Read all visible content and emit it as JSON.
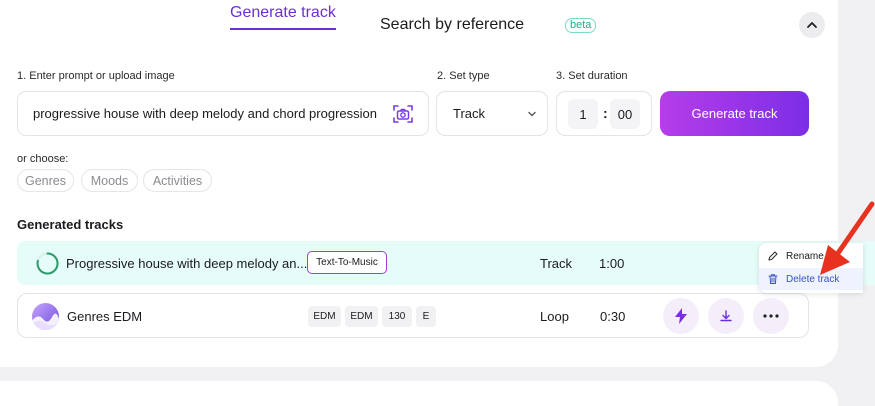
{
  "header": {
    "tab_generate": "Generate track",
    "tab_search": "Search by reference",
    "beta_badge": "beta"
  },
  "form": {
    "step1_label": "1. Enter prompt or upload image",
    "step2_label": "2. Set type",
    "step3_label": "3. Set duration",
    "prompt_value": "progressive house with deep melody and chord progression",
    "type_value": "Track",
    "duration_minutes": "1",
    "duration_separator": ":",
    "duration_seconds": "00",
    "generate_button": "Generate track"
  },
  "choose": {
    "label": "or choose:",
    "chips": [
      "Genres",
      "Moods",
      "Activities"
    ]
  },
  "generated": {
    "title": "Generated tracks",
    "rows": [
      {
        "title": "Progressive house with deep melody an...",
        "badge": "Text-To-Music",
        "type": "Track",
        "duration": "1:00"
      },
      {
        "title": "Genres EDM",
        "tags": [
          "EDM",
          "EDM",
          "130",
          "E"
        ],
        "type": "Loop",
        "duration": "0:30"
      }
    ]
  },
  "context_menu": {
    "rename": "Rename",
    "delete": "Delete track"
  },
  "colors": {
    "accent_purple": "#6a2fd9",
    "generate_gradient_start": "#b63de9",
    "generate_gradient_end": "#7c2ee6",
    "processing_row_bg": "#e6fcf8",
    "beta_green": "#26a889",
    "arrow_red": "#e8321f"
  },
  "icons": {
    "collapse": "chevron-up-icon",
    "upload_image": "camera-icon",
    "type_dropdown": "chevron-down-icon",
    "processing": "spinner-icon",
    "boost": "lightning-icon",
    "download": "download-icon",
    "more": "more-dots-icon",
    "rename": "pencil-icon",
    "delete": "trash-icon",
    "annotation": "red-arrow-icon"
  }
}
